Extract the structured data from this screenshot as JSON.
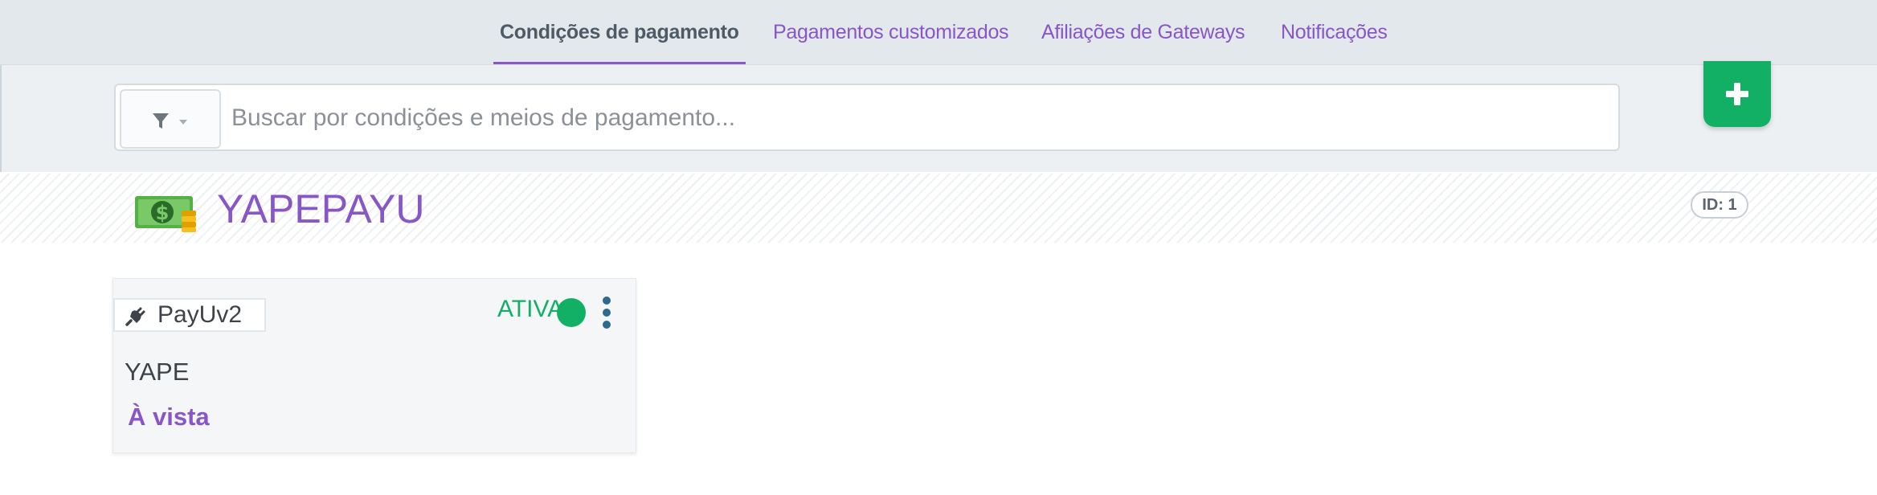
{
  "tabs": [
    {
      "label": "Condições de pagamento",
      "active": true
    },
    {
      "label": "Pagamentos customizados",
      "active": false
    },
    {
      "label": "Afiliações de Gateways",
      "active": false
    },
    {
      "label": "Notificações",
      "active": false
    }
  ],
  "search": {
    "placeholder": "Buscar por condições e meios de pagamento...",
    "value": "",
    "filter_icon": "filter-icon",
    "dropdown_icon": "caret-down-icon"
  },
  "add_button": {
    "icon": "plus-icon",
    "color": "#12b065"
  },
  "group": {
    "title": "YAPEPAYU",
    "icon": "money-bill-icon",
    "id_label": "ID: 1"
  },
  "card": {
    "gateway_icon": "plug-icon",
    "gateway": "PayUv2",
    "status": "ATIVA",
    "status_color": "#12b065",
    "menu_icon": "kebab-menu-icon",
    "payment_method": "YAPE",
    "condition": "À vista"
  },
  "colors": {
    "accent": "#8856c6",
    "success": "#12b065"
  }
}
